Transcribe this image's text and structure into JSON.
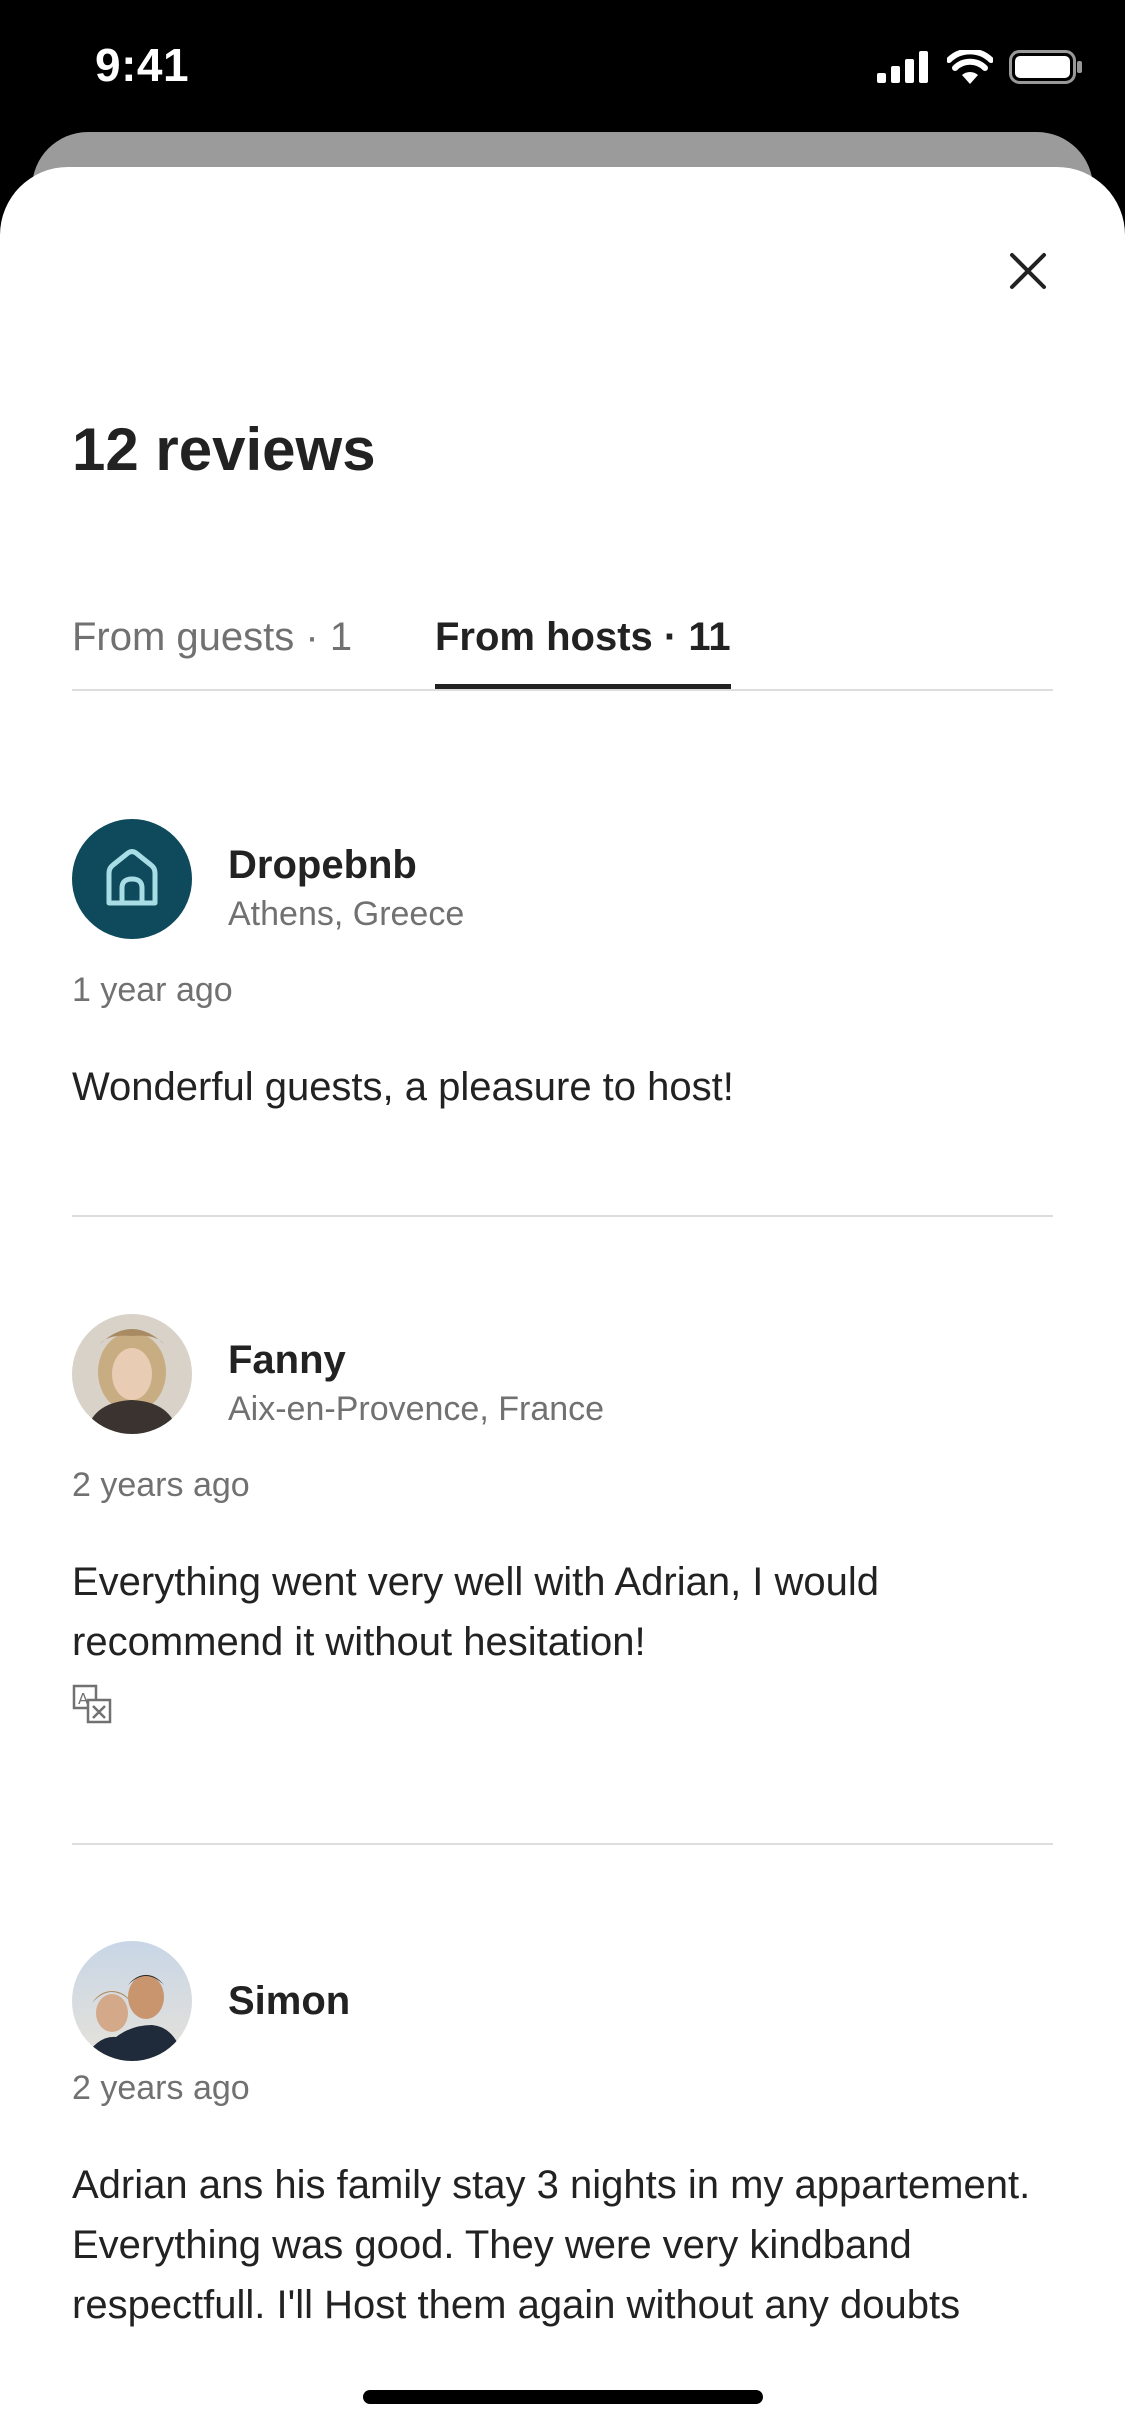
{
  "status_bar": {
    "time": "9:41"
  },
  "sheet": {
    "title": "12 reviews",
    "close_icon": "close-icon",
    "tabs": [
      {
        "label": "From guests · 1",
        "active": false
      },
      {
        "label": "From hosts · 11",
        "active": true
      }
    ]
  },
  "reviews": [
    {
      "name": "Dropebnb",
      "location": "Athens, Greece",
      "time": "1 year ago",
      "text": "Wonderful guests, a pleasure to host!",
      "avatar": "house-logo-avatar"
    },
    {
      "name": "Fanny",
      "location": "Aix-en-Provence, France",
      "time": "2 years ago",
      "text": "Everything went very well with Adrian, I would recommend it without hesitation!",
      "avatar": "user-photo-avatar",
      "translate_icon": "translate-icon"
    },
    {
      "name": "Simon",
      "location": "",
      "time": "2 years ago",
      "text": "Adrian ans his family stay 3 nights in my appartement. Everything was good. They were very kindband respectfull. I'll Host them again without any doubts",
      "avatar": "user-photo-avatar"
    }
  ],
  "colors": {
    "primary_text": "#222222",
    "secondary_text": "#717171",
    "divider": "#dddddd",
    "host_logo_bg": "#0e4a5c"
  }
}
